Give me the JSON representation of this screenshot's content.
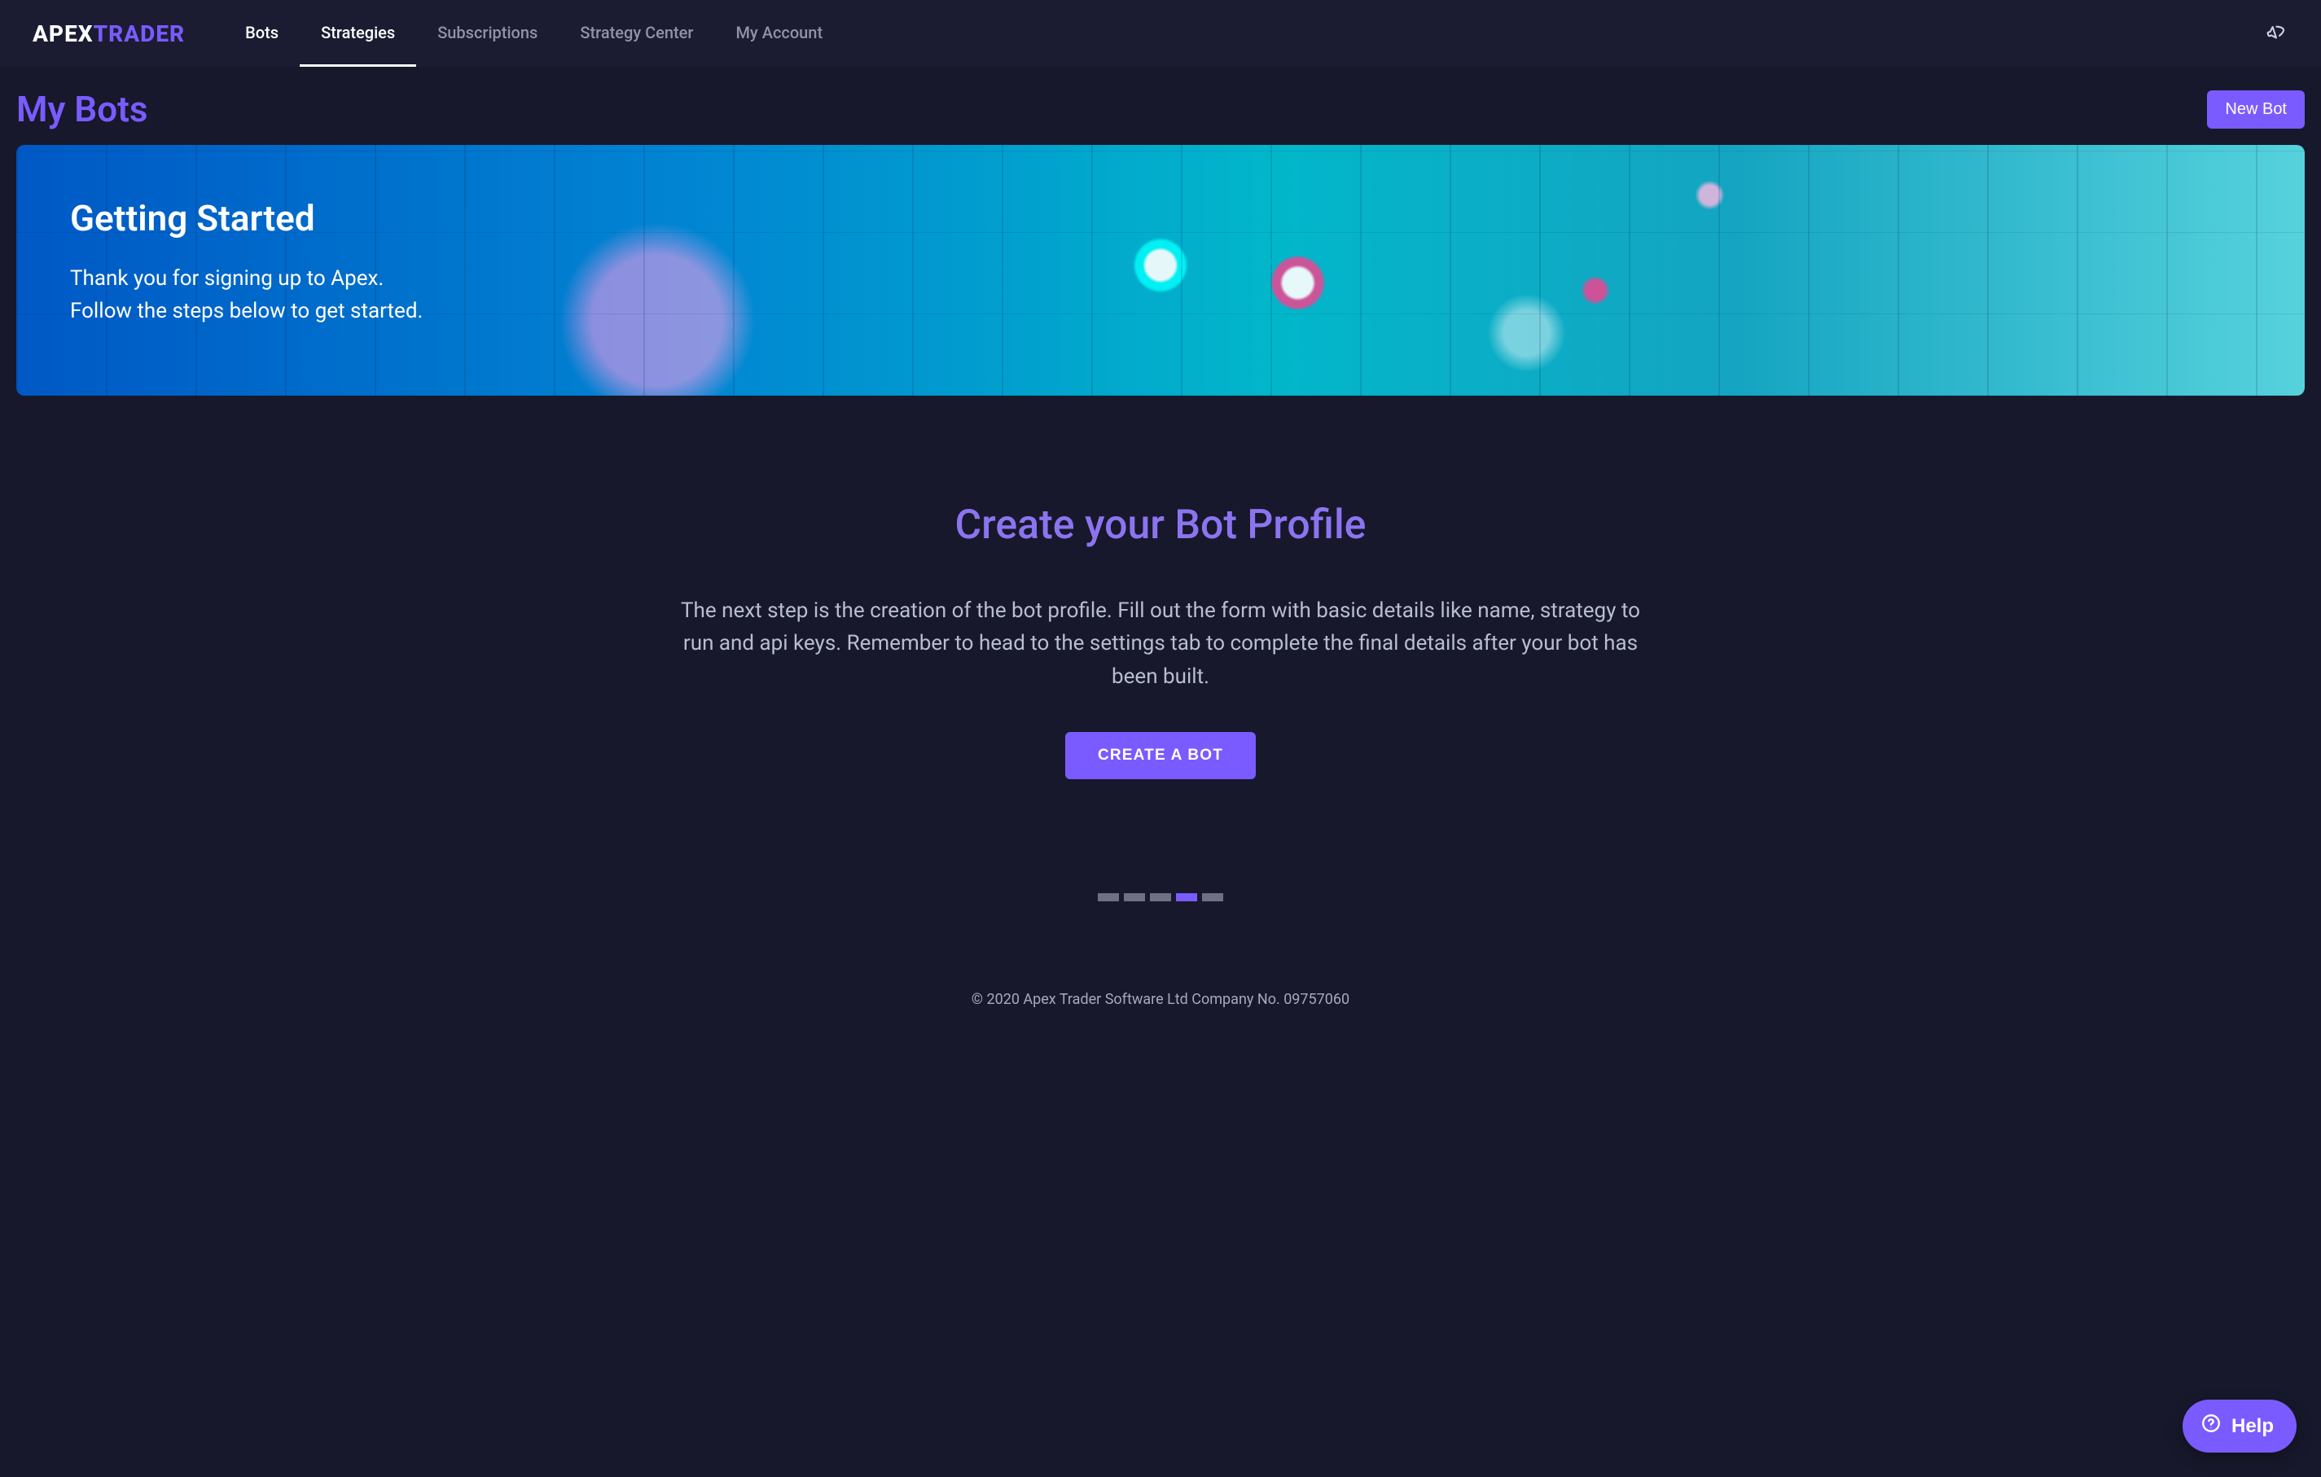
{
  "brand": {
    "left": "APEX",
    "right": "TRADER"
  },
  "nav": {
    "items": [
      {
        "label": "Bots",
        "highlight": true
      },
      {
        "label": "Strategies",
        "active": true
      },
      {
        "label": "Subscriptions"
      },
      {
        "label": "Strategy Center"
      },
      {
        "label": "My Account"
      }
    ]
  },
  "page": {
    "title": "My Bots",
    "new_bot_label": "New Bot"
  },
  "hero": {
    "title": "Getting Started",
    "line1": "Thank you for signing up to Apex.",
    "line2": "Follow the steps below to get started."
  },
  "create": {
    "title": "Create your Bot Profile",
    "desc": "The next step is the creation of the bot profile. Fill out the form with basic details like name, strategy to run and api keys. Remember to head to the settings tab to complete the final details after your bot has been built.",
    "button_label": "CREATE A BOT"
  },
  "pagination": {
    "total": 5,
    "active_index": 3
  },
  "footer": {
    "text": "© 2020 Apex Trader Software Ltd Company No. 09757060"
  },
  "help": {
    "label": "Help"
  }
}
